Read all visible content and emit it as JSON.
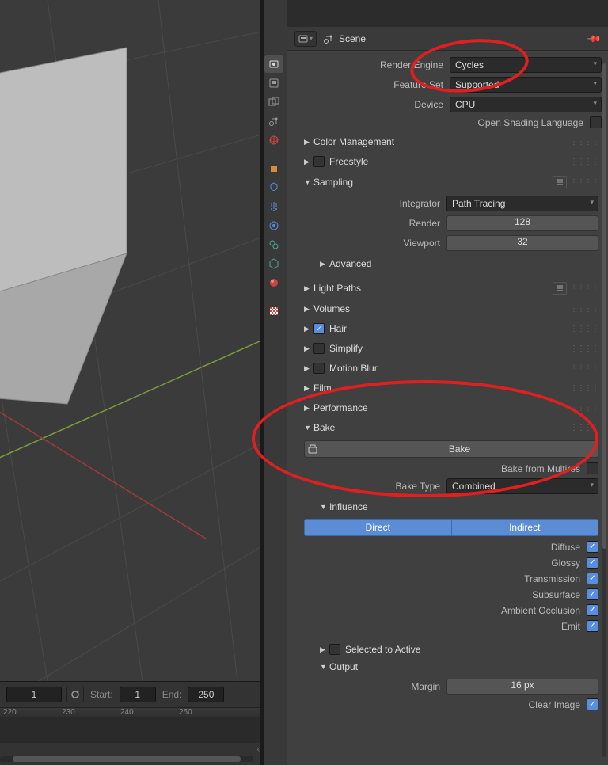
{
  "header": {
    "scene_label": "Scene"
  },
  "render": {
    "engine_label": "Render Engine",
    "engine_value": "Cycles",
    "featureset_label": "Feature Set",
    "featureset_value": "Supported",
    "device_label": "Device",
    "device_value": "CPU",
    "osl_label": "Open Shading Language"
  },
  "panels": {
    "color_mgmt": "Color Management",
    "freestyle": "Freestyle",
    "sampling": "Sampling",
    "advanced": "Advanced",
    "light_paths": "Light Paths",
    "volumes": "Volumes",
    "hair": "Hair",
    "simplify": "Simplify",
    "motion_blur": "Motion Blur",
    "film": "Film",
    "performance": "Performance",
    "bake": "Bake",
    "influence": "Influence",
    "sel_to_active": "Selected to Active",
    "output": "Output"
  },
  "sampling": {
    "integrator_label": "Integrator",
    "integrator_value": "Path Tracing",
    "render_label": "Render",
    "render_value": "128",
    "viewport_label": "Viewport",
    "viewport_value": "32"
  },
  "bake": {
    "button": "Bake",
    "from_multires": "Bake from Multires",
    "type_label": "Bake Type",
    "type_value": "Combined"
  },
  "influence": {
    "direct": "Direct",
    "indirect": "Indirect",
    "diffuse": "Diffuse",
    "glossy": "Glossy",
    "transmission": "Transmission",
    "subsurface": "Subsurface",
    "ao": "Ambient Occlusion",
    "emit": "Emit"
  },
  "output": {
    "margin_label": "Margin",
    "margin_value": "16 px",
    "clear_image": "Clear Image"
  },
  "timeline": {
    "frame": "1",
    "start_label": "Start:",
    "start": "1",
    "end_label": "End:",
    "end": "250",
    "ticks": [
      "220",
      "230",
      "240",
      "250"
    ]
  },
  "vtabs": {
    "render": "render-tab",
    "output": "output-tab",
    "viewlayer": "viewlayer-tab",
    "scene": "scene-tab",
    "world": "world-tab",
    "object": "object-tab",
    "modifier": "modifier-tab",
    "particle": "particle-tab",
    "physics": "physics-tab",
    "constraint": "constraint-tab",
    "mesh": "mesh-tab",
    "material": "material-tab",
    "texture": "texture-tab"
  }
}
